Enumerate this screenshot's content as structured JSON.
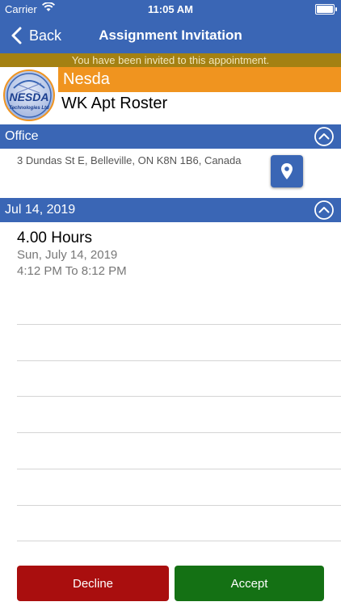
{
  "status_bar": {
    "carrier": "Carrier",
    "time": "11:05 AM"
  },
  "nav": {
    "back_label": "Back",
    "title": "Assignment Invitation"
  },
  "banner": {
    "text": "You have been invited to this appointment."
  },
  "logo": {
    "text_main": "NESDA",
    "text_sub": "Technologies Ltd"
  },
  "company": {
    "name": "Nesda",
    "roster": "WK Apt Roster"
  },
  "location": {
    "header": "Office",
    "address": "3 Dundas St E, Belleville, ON K8N 1B6, Canada"
  },
  "schedule": {
    "header": "Jul 14, 2019",
    "duration": "4.00 Hours",
    "date": "Sun, July 14, 2019",
    "time_range": "4:12 PM To 8:12 PM"
  },
  "actions": {
    "decline_label": "Decline",
    "accept_label": "Accept"
  },
  "colors": {
    "primary": "#3a66b5",
    "banner": "#a48112",
    "orange": "#f0941f",
    "decline": "#a90e0e",
    "accept": "#147114"
  }
}
